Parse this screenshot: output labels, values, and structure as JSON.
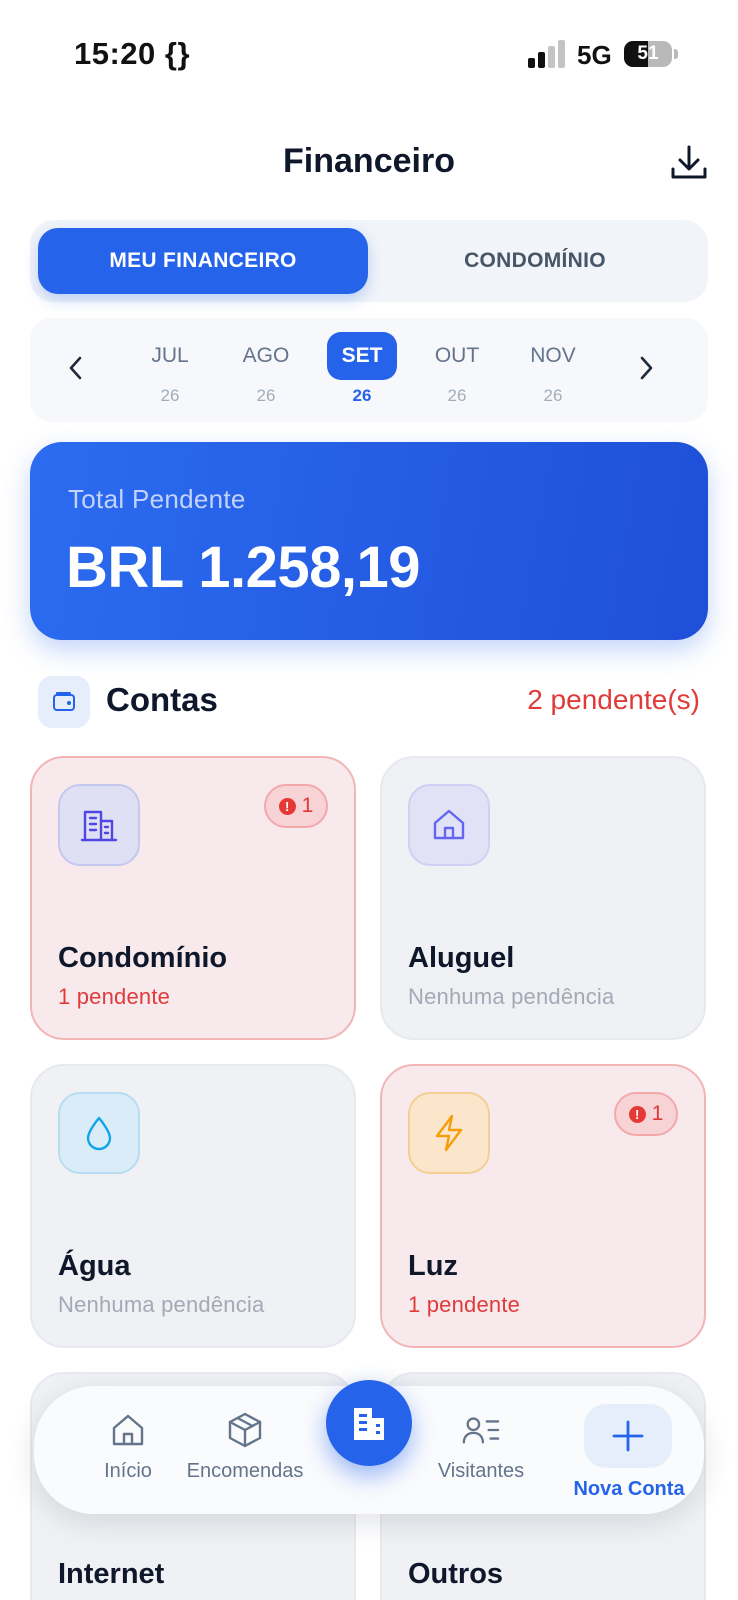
{
  "status_bar": {
    "time": "15:20 {}",
    "network": "5G",
    "battery": "51",
    "battery_level": 0.51
  },
  "header": {
    "title": "Financeiro",
    "download_icon": "download-icon"
  },
  "tabs": [
    {
      "label": "MEU FINANCEIRO",
      "active": true
    },
    {
      "label": "CONDOMÍNIO",
      "active": false
    }
  ],
  "months": [
    {
      "name": "JUL",
      "year": "26",
      "active": false
    },
    {
      "name": "AGO",
      "year": "26",
      "active": false
    },
    {
      "name": "SET",
      "year": "26",
      "active": true
    },
    {
      "name": "OUT",
      "year": "26",
      "active": false
    },
    {
      "name": "NOV",
      "year": "26",
      "active": false
    }
  ],
  "total": {
    "label": "Total Pendente",
    "value": "BRL 1.258,19"
  },
  "section": {
    "title": "Contas",
    "count": "2 pendente(s)",
    "icon": "wallet-icon"
  },
  "cards": [
    {
      "title": "Condomínio",
      "subtitle": "1 pendente",
      "pending": true,
      "badge": "1",
      "icon": "building-icon",
      "accent": "#4f46e5"
    },
    {
      "title": "Aluguel",
      "subtitle": "Nenhuma pendência",
      "pending": false,
      "icon": "home-icon",
      "accent": "#6366f1"
    },
    {
      "title": "Água",
      "subtitle": "Nenhuma pendência",
      "pending": false,
      "icon": "water-drop-icon",
      "accent": "#0ea5e9"
    },
    {
      "title": "Luz",
      "subtitle": "1 pendente",
      "pending": true,
      "badge": "1",
      "icon": "lightning-icon",
      "accent": "#f59e0b"
    },
    {
      "title": "Internet"
    },
    {
      "title": "Outros"
    }
  ],
  "nav": {
    "items": [
      {
        "label": "Início",
        "icon": "home-icon"
      },
      {
        "label": "Encomendas",
        "icon": "package-icon"
      },
      {
        "label": "Visitantes",
        "icon": "visitors-icon"
      }
    ],
    "center_icon": "building-icon",
    "new_account": {
      "label": "Nova Conta",
      "icon": "plus-icon"
    }
  },
  "colors": {
    "primary": "#2563eb",
    "danger": "#e03b3b"
  }
}
